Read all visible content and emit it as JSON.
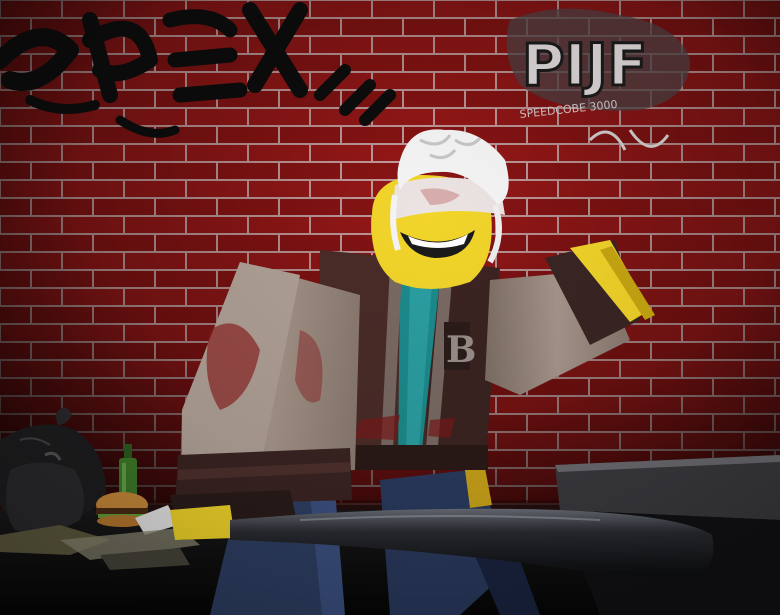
{
  "scene": {
    "description_type": "3d-game-render",
    "letter_patch": "B",
    "graffiti": {
      "main_tag": "PIJF",
      "small_tag": "SPEEDCOBE 3000"
    }
  },
  "colors": {
    "brick": "#8a1414",
    "mortar": "#c9a2a2",
    "skin": "#f2d52a",
    "jacket": "#3b2421",
    "sleeve": "#9c8a7e",
    "shirt": "#1d8b8d",
    "jeans": "#2e3f63",
    "bat": "#1d1f24"
  }
}
